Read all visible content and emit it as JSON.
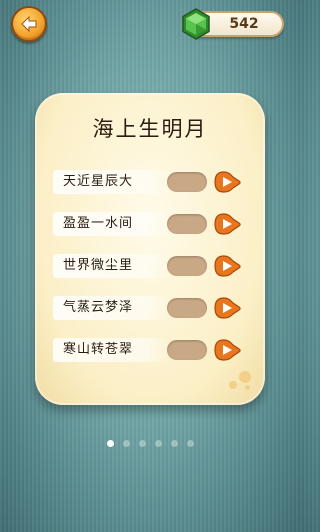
{
  "header": {
    "back_icon": "back-arrow-icon",
    "coins": "542",
    "gem_icon": "green-hexagon-gem-icon"
  },
  "puzzle": {
    "title": "海上生明月",
    "rows": [
      {
        "text": "天近星辰大"
      },
      {
        "text": "盈盈一水间"
      },
      {
        "text": "世界微尘里"
      },
      {
        "text": "气蒸云梦泽"
      },
      {
        "text": "寒山转苍翠"
      }
    ],
    "play_icon": "orange-play-icon"
  },
  "pager": {
    "total": 6,
    "active": 0
  },
  "colors": {
    "accent_orange": "#f08a24",
    "card": "#fbefc6",
    "gem_green": "#3fae3a",
    "slot": "#c9a886"
  }
}
